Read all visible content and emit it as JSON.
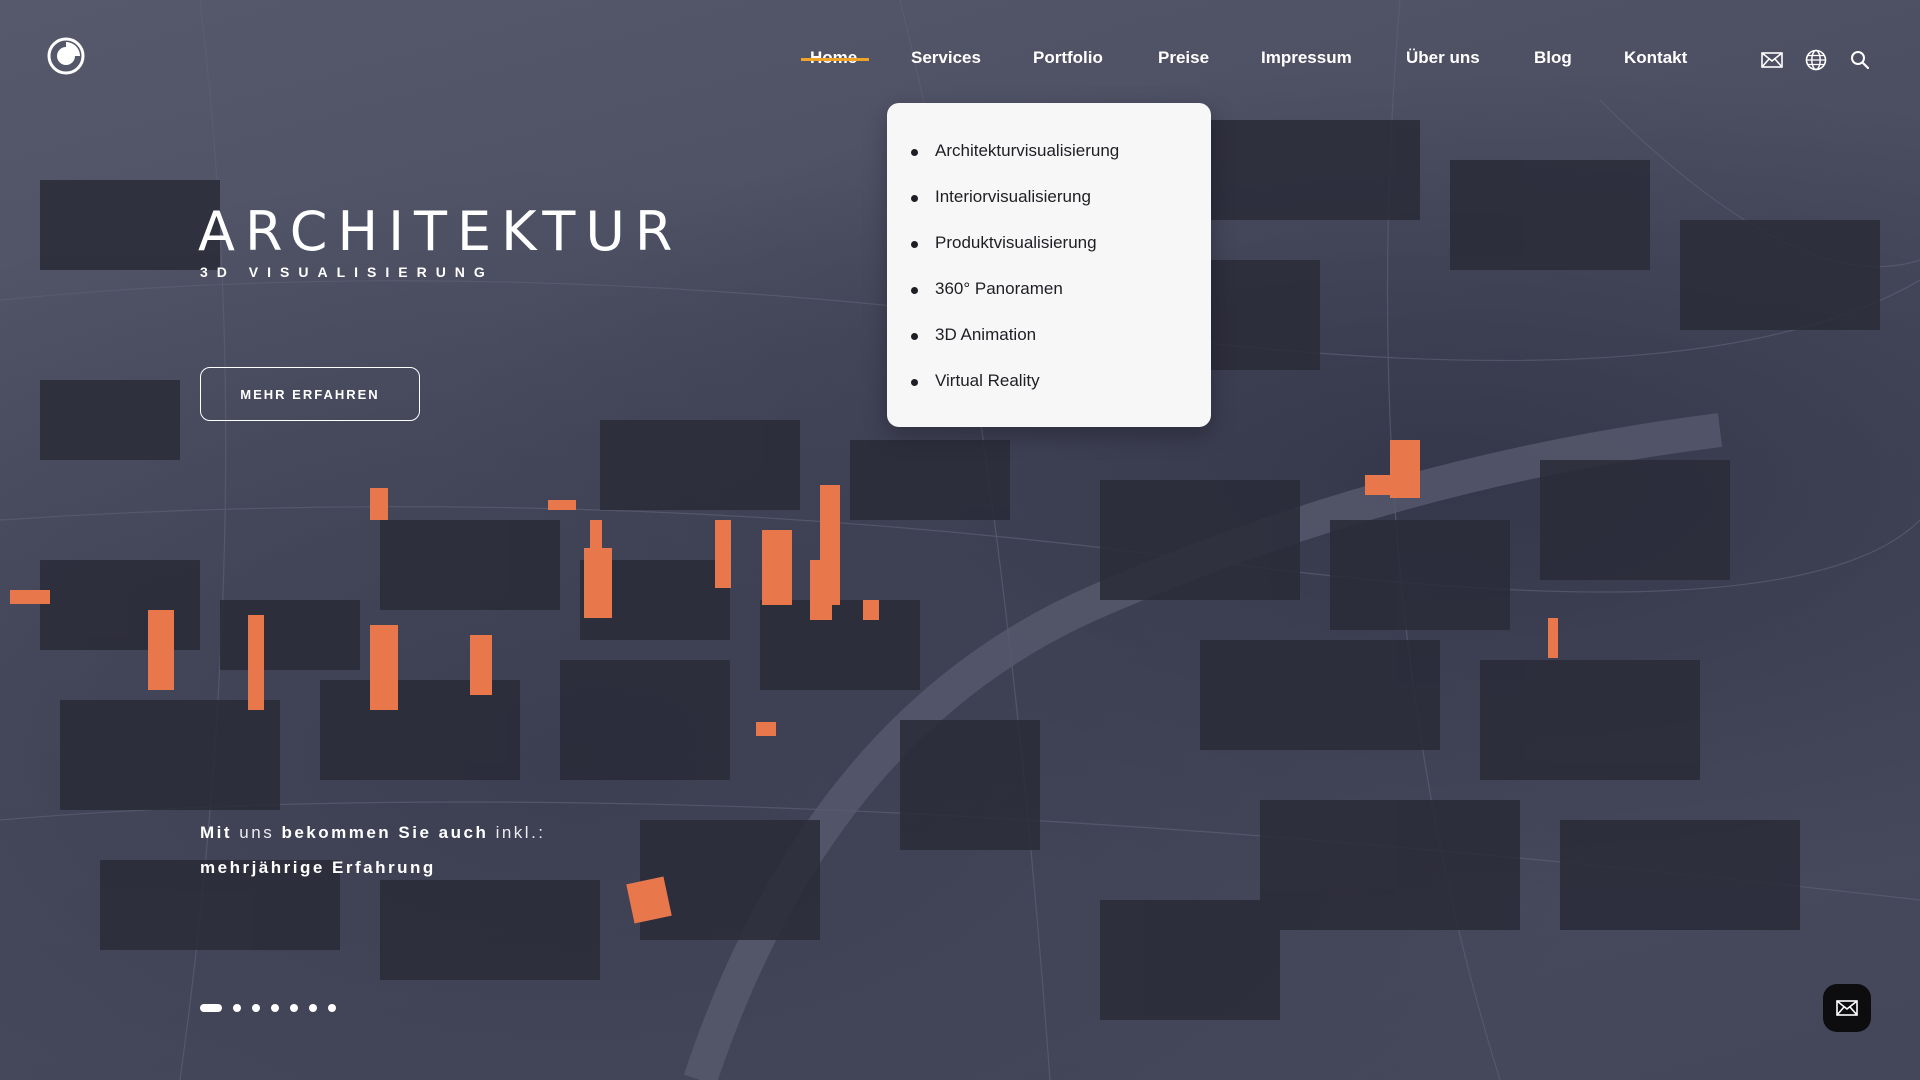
{
  "header": {
    "logo_icon": "circle-logo-icon",
    "nav": [
      {
        "label": "Home",
        "active": true
      },
      {
        "label": "Services"
      },
      {
        "label": "Portfolio"
      },
      {
        "label": "Preise"
      },
      {
        "label": "Impressum"
      },
      {
        "label": "Über uns"
      },
      {
        "label": "Blog"
      },
      {
        "label": "Kontakt"
      }
    ],
    "icons": [
      "mail-icon",
      "globe-icon",
      "search-icon"
    ],
    "accent_color": "#f0a329"
  },
  "services_dropdown": {
    "items": [
      {
        "label": "Architekturvisualisierung"
      },
      {
        "label": "Interiorvisualisierung"
      },
      {
        "label": "Produktvisualisierung"
      },
      {
        "label": "360° Panoramen"
      },
      {
        "label": "3D Animation"
      },
      {
        "label": "Virtual Reality"
      }
    ]
  },
  "hero": {
    "title": "ARCHITEKTUR",
    "subtitle": "3D VISUALISIERUNG",
    "cta_label": "MEHR ERFAHREN",
    "tagline": {
      "w1": "Mit",
      "w2": "uns",
      "w3": "bekommen Sie auch",
      "w4": "inkl.:",
      "line2": "mehrjährige Erfahrung"
    }
  },
  "slider": {
    "count": 7,
    "active_index": 0
  },
  "floating_button": {
    "icon": "mail-icon"
  },
  "colors": {
    "background": "#4a4c60",
    "highlight": "#e8774c",
    "dropdown_bg": "#f7f7f7"
  }
}
